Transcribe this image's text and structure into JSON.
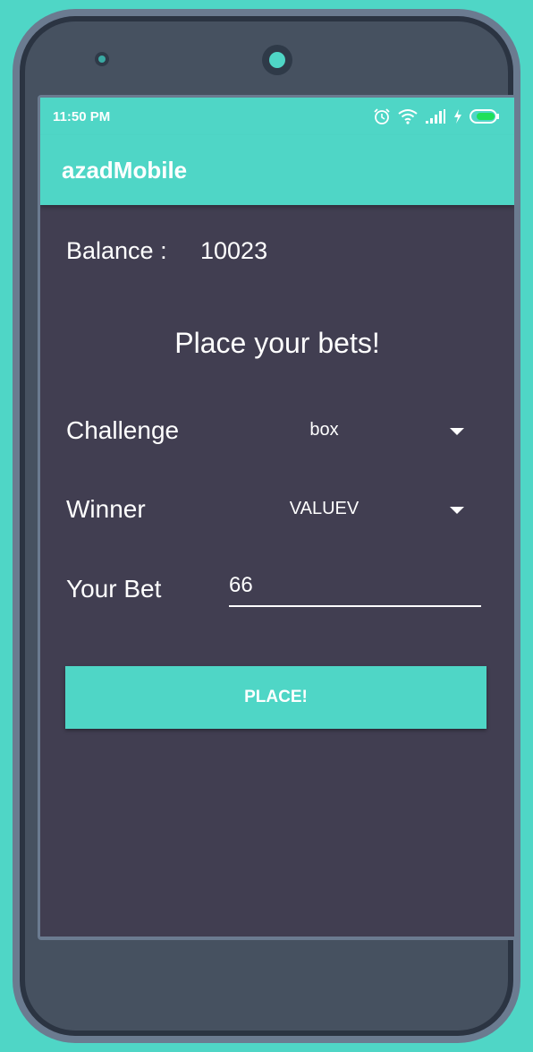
{
  "status_bar": {
    "time": "11:50 PM",
    "icons": [
      "alarm-icon",
      "wifi-icon",
      "signal-icon",
      "charging-icon",
      "battery-icon"
    ]
  },
  "app_bar": {
    "title": "azadMobile"
  },
  "balance": {
    "label": "Balance :",
    "value": "10023"
  },
  "heading": "Place your bets!",
  "form": {
    "challenge": {
      "label": "Challenge",
      "selected": "box"
    },
    "winner": {
      "label": "Winner",
      "selected": "VALUEV"
    },
    "bet": {
      "label": "Your Bet",
      "value": "66"
    }
  },
  "place_button": {
    "label": "PLACE!"
  },
  "colors": {
    "accent": "#4fd6c6",
    "screen_background": "#413e51",
    "text": "#ffffff"
  }
}
